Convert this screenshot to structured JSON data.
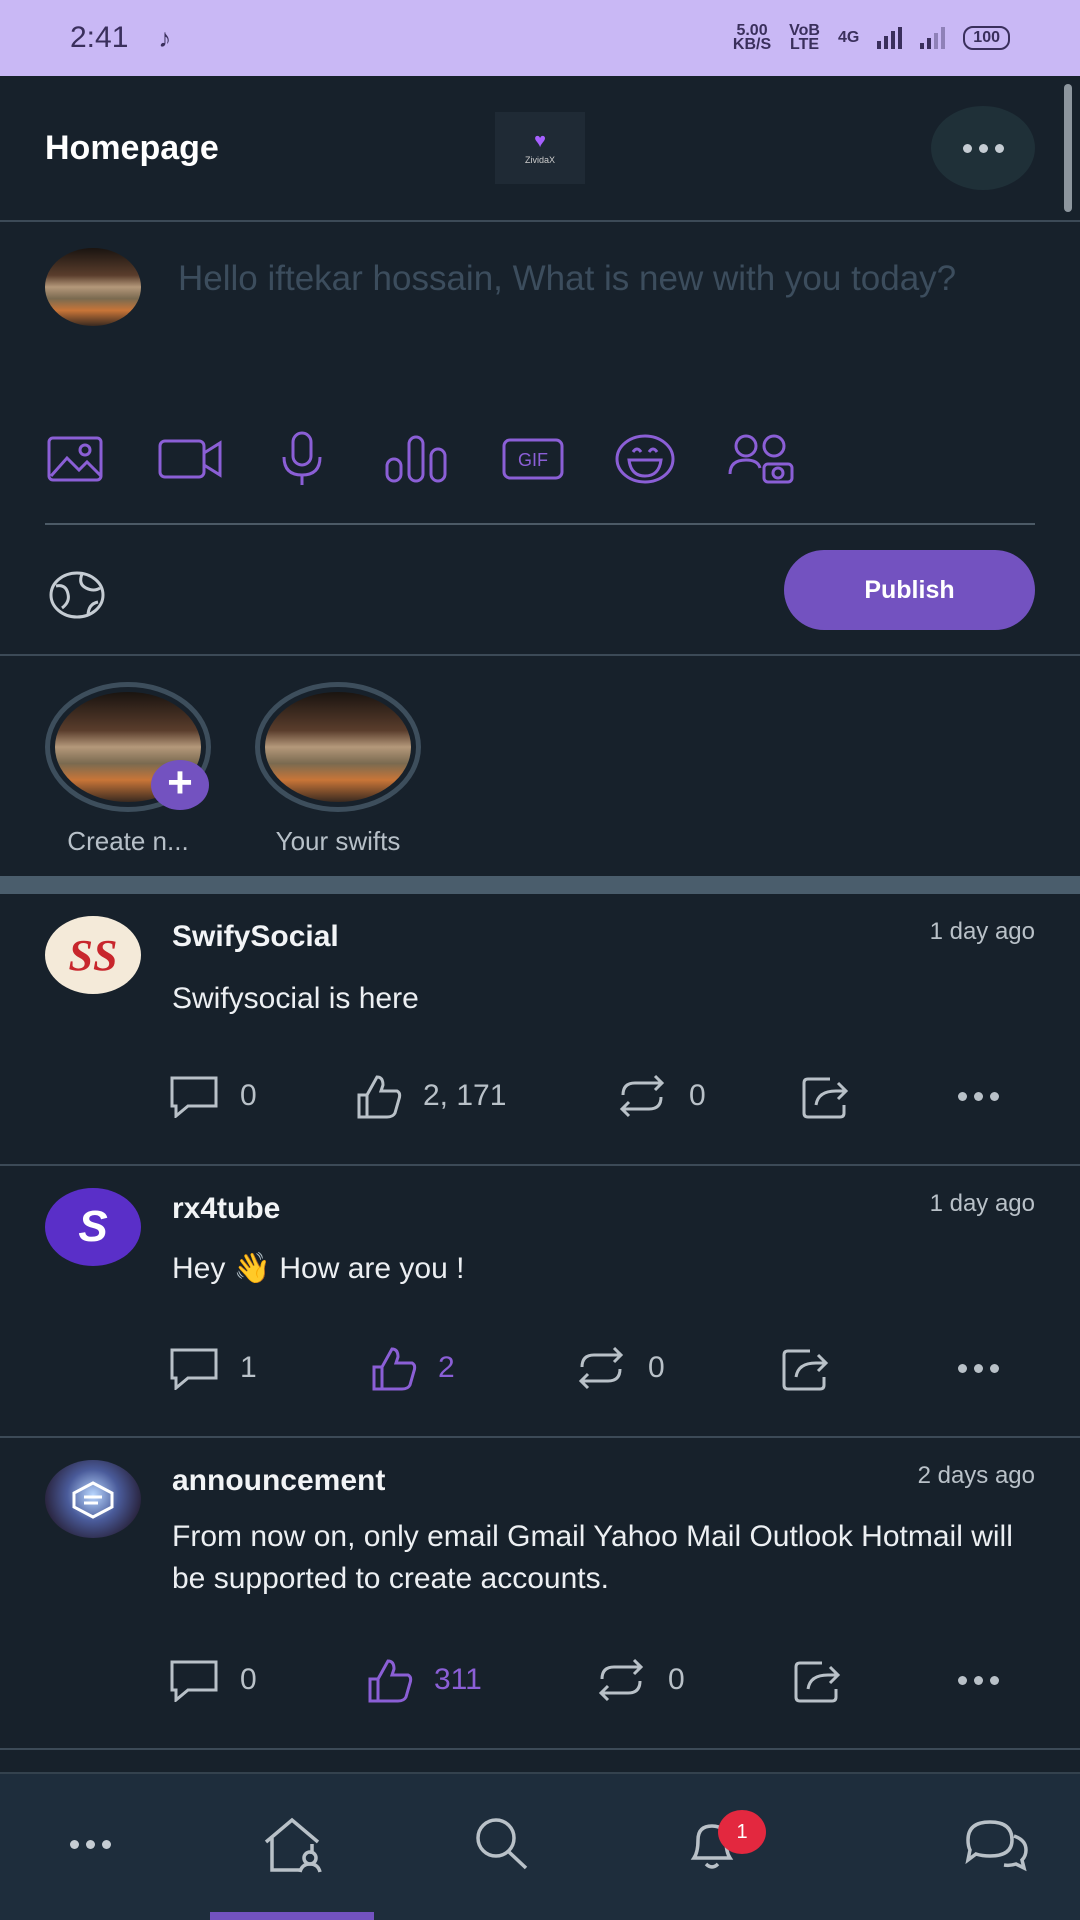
{
  "status_bar": {
    "time": "2:41",
    "net_speed_value": "5.00",
    "net_speed_unit": "KB/S",
    "carrier_top": "VoB",
    "carrier_bottom": "LTE",
    "network": "4G",
    "battery": "100"
  },
  "header": {
    "title": "Homepage",
    "logo_text": "ZividaX"
  },
  "composer": {
    "placeholder": "Hello iftekar hossain, What is new with you today?",
    "gif_label": "GIF",
    "publish_label": "Publish",
    "tools": [
      "image-icon",
      "video-icon",
      "microphone-icon",
      "poll-icon",
      "gif-icon",
      "emoji-icon",
      "group-icon"
    ]
  },
  "stories": [
    {
      "label": "Create n..."
    },
    {
      "label": "Your swifts"
    }
  ],
  "posts": [
    {
      "avatar_text": "SS",
      "author": "SwifySocial",
      "time": "1 day ago",
      "body": "Swifysocial is here",
      "comments": "0",
      "likes": "2, 171",
      "reposts": "0",
      "liked": false
    },
    {
      "avatar_text": "S",
      "author": "rx4tube",
      "time": "1 day ago",
      "body": "Hey 👋 How are you !",
      "comments": "1",
      "likes": "2",
      "reposts": "0",
      "liked": true
    },
    {
      "avatar_text": "",
      "author": "announcement",
      "time": "2 days ago",
      "body": "From now on, only email Gmail Yahoo Mail Outlook Hotmail will be supported to create accounts.",
      "comments": "0",
      "likes": "311",
      "reposts": "0",
      "liked": true
    }
  ],
  "bottom_nav": {
    "items": [
      "more-icon",
      "home-icon",
      "search-icon",
      "notifications-icon",
      "messages-icon"
    ],
    "active": "home",
    "notification_count": "1"
  },
  "colors": {
    "accent": "#7352c0",
    "background": "#17212b",
    "status_bar": "#c9b8f5",
    "badge": "#e3283f"
  }
}
